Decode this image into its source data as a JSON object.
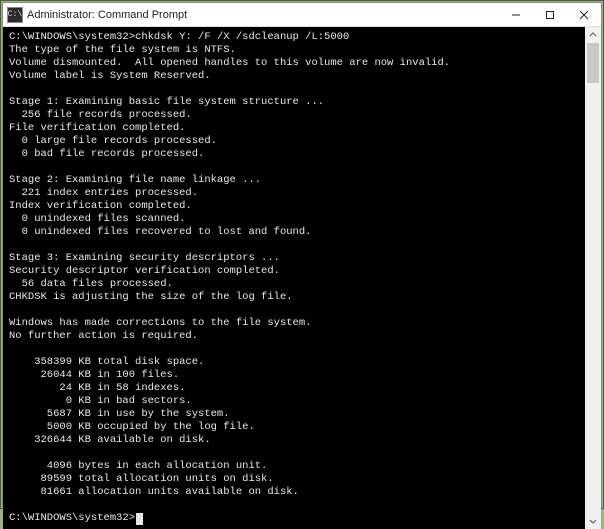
{
  "window": {
    "icon_label": "C:\\",
    "title": "Administrator: Command Prompt"
  },
  "c": {
    "prompt1": "C:\\WINDOWS\\system32>",
    "command": "chkdsk Y: /F /X /sdcleanup /L:5000",
    "l01": "The type of the file system is NTFS.",
    "l02": "Volume dismounted.  All opened handles to this volume are now invalid.",
    "l03": "Volume label is System Reserved.",
    "blank": " ",
    "l04": "Stage 1: Examining basic file system structure ...",
    "l05": "  256 file records processed.",
    "l06": "File verification completed.",
    "l07": "  0 large file records processed.",
    "l08": "  0 bad file records processed.",
    "l09": "Stage 2: Examining file name linkage ...",
    "l10": "  221 index entries processed.",
    "l11": "Index verification completed.",
    "l12": "  0 unindexed files scanned.",
    "l13": "  0 unindexed files recovered to lost and found.",
    "l14": "Stage 3: Examining security descriptors ...",
    "l15": "Security descriptor verification completed.",
    "l16": "  56 data files processed.",
    "l17": "CHKDSK is adjusting the size of the log file.",
    "l18": "Windows has made corrections to the file system.",
    "l19": "No further action is required.",
    "l20": "    358399 KB total disk space.",
    "l21": "     26044 KB in 100 files.",
    "l22": "        24 KB in 58 indexes.",
    "l23": "         0 KB in bad sectors.",
    "l24": "      5687 KB in use by the system.",
    "l25": "      5000 KB occupied by the log file.",
    "l26": "    326644 KB available on disk.",
    "l27": "      4096 bytes in each allocation unit.",
    "l28": "     89599 total allocation units on disk.",
    "l29": "     81661 allocation units available on disk.",
    "prompt2": "C:\\WINDOWS\\system32>"
  }
}
